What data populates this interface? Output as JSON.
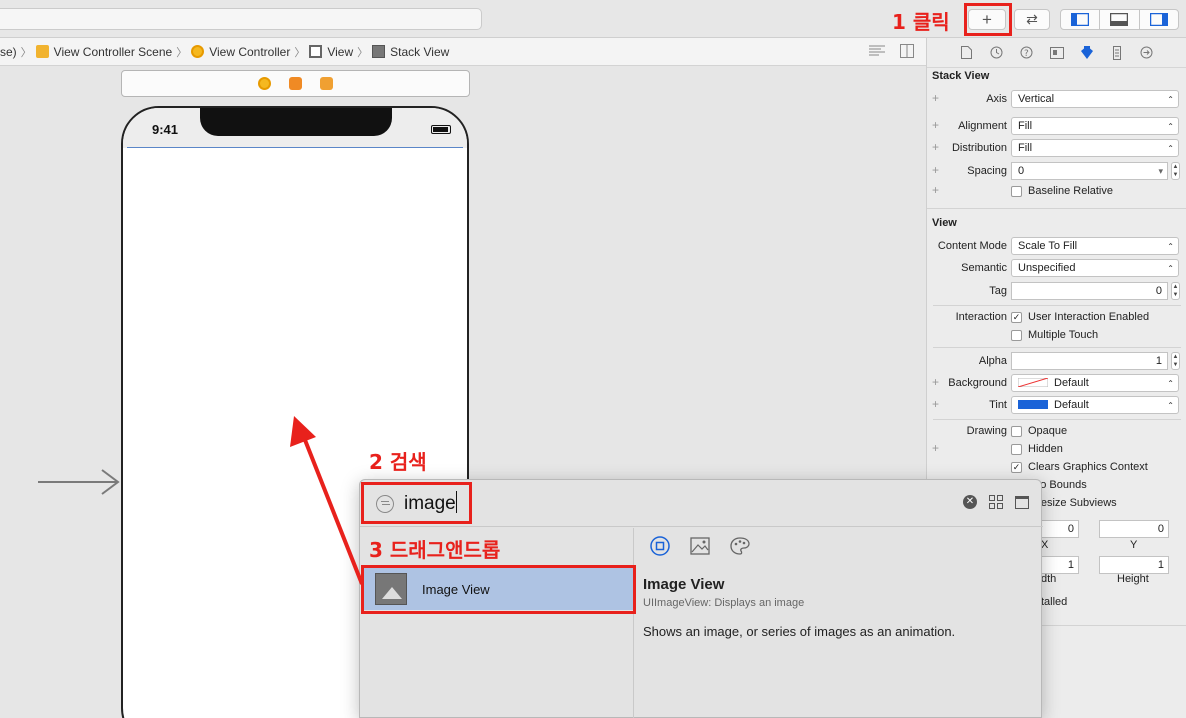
{
  "toolbar": {
    "add_button_label": "+",
    "swap_label": "⇄"
  },
  "annotations": {
    "step1": "1 클릭",
    "step2": "2 검색",
    "step3": "3 드래그앤드롭"
  },
  "breadcrumb": {
    "items": [
      "se)",
      "View Controller Scene",
      "View Controller",
      "View",
      "Stack View"
    ]
  },
  "phone": {
    "time": "9:41"
  },
  "inspector": {
    "stack_view_title": "Stack View",
    "axis_label": "Axis",
    "axis_value": "Vertical",
    "alignment_label": "Alignment",
    "alignment_value": "Fill",
    "distribution_label": "Distribution",
    "distribution_value": "Fill",
    "spacing_label": "Spacing",
    "spacing_value": "0",
    "baseline_label": "Baseline Relative",
    "view_title": "View",
    "content_mode_label": "Content Mode",
    "content_mode_value": "Scale To Fill",
    "semantic_label": "Semantic",
    "semantic_value": "Unspecified",
    "tag_label": "Tag",
    "tag_value": "0",
    "interaction_label": "Interaction",
    "user_interaction_label": "User Interaction Enabled",
    "multiple_touch_label": "Multiple Touch",
    "alpha_label": "Alpha",
    "alpha_value": "1",
    "background_label": "Background",
    "background_value": "Default",
    "tint_label": "Tint",
    "tint_value": "Default",
    "drawing_label": "Drawing",
    "opaque_label": "Opaque",
    "hidden_label": "Hidden",
    "clears_label": "Clears Graphics Context",
    "clip_label": "p to Bounds",
    "autoresize_label": "toresize Subviews",
    "x_value": "0",
    "y_value": "0",
    "x_label": "X",
    "y_label": "Y",
    "width_value": "1",
    "height_value": "1",
    "width_label": "dth",
    "height_label": "Height",
    "installed_label": "talled",
    "tint_color": "#1a63d8"
  },
  "library": {
    "search_value": "image",
    "item_label": "Image View",
    "detail_title": "Image View",
    "detail_subtitle": "UIImageView: Displays an image",
    "detail_description": "Shows an image, or series of images as an animation."
  },
  "colors": {
    "annotation_red": "#e8211c",
    "selection_blue": "#aec3e3",
    "accent_blue": "#1a63d8"
  }
}
